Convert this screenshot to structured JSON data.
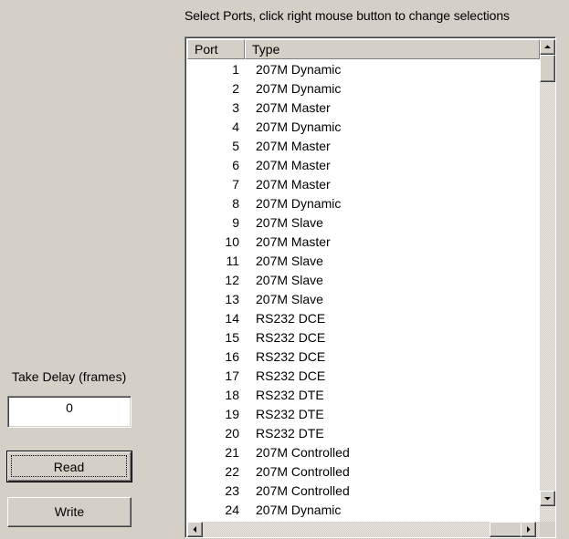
{
  "instructions": "Select Ports, click right mouse button to change selections",
  "list": {
    "columns": {
      "port": "Port",
      "type": "Type"
    },
    "rows": [
      {
        "port": "1",
        "type": "207M Dynamic"
      },
      {
        "port": "2",
        "type": "207M Dynamic"
      },
      {
        "port": "3",
        "type": "207M Master"
      },
      {
        "port": "4",
        "type": "207M Dynamic"
      },
      {
        "port": "5",
        "type": "207M Master"
      },
      {
        "port": "6",
        "type": "207M Master"
      },
      {
        "port": "7",
        "type": "207M Master"
      },
      {
        "port": "8",
        "type": "207M Dynamic"
      },
      {
        "port": "9",
        "type": "207M Slave"
      },
      {
        "port": "10",
        "type": "207M Master"
      },
      {
        "port": "11",
        "type": "207M Slave"
      },
      {
        "port": "12",
        "type": "207M Slave"
      },
      {
        "port": "13",
        "type": "207M Slave"
      },
      {
        "port": "14",
        "type": "RS232 DCE"
      },
      {
        "port": "15",
        "type": "RS232 DCE"
      },
      {
        "port": "16",
        "type": "RS232 DCE"
      },
      {
        "port": "17",
        "type": "RS232 DCE"
      },
      {
        "port": "18",
        "type": "RS232 DTE"
      },
      {
        "port": "19",
        "type": "RS232 DTE"
      },
      {
        "port": "20",
        "type": "RS232 DTE"
      },
      {
        "port": "21",
        "type": "207M Controlled"
      },
      {
        "port": "22",
        "type": "207M Controlled"
      },
      {
        "port": "23",
        "type": "207M Controlled"
      },
      {
        "port": "24",
        "type": "207M Dynamic"
      }
    ]
  },
  "take_delay": {
    "label": "Take Delay (frames)",
    "value": "0"
  },
  "buttons": {
    "read": "Read",
    "write": "Write"
  },
  "icons": {
    "scroll_up": "arrow-up-icon",
    "scroll_down": "arrow-down-icon",
    "scroll_left": "arrow-left-icon",
    "scroll_right": "arrow-right-icon"
  },
  "colors": {
    "face": "#d4d0c8",
    "window": "#ffffff"
  }
}
